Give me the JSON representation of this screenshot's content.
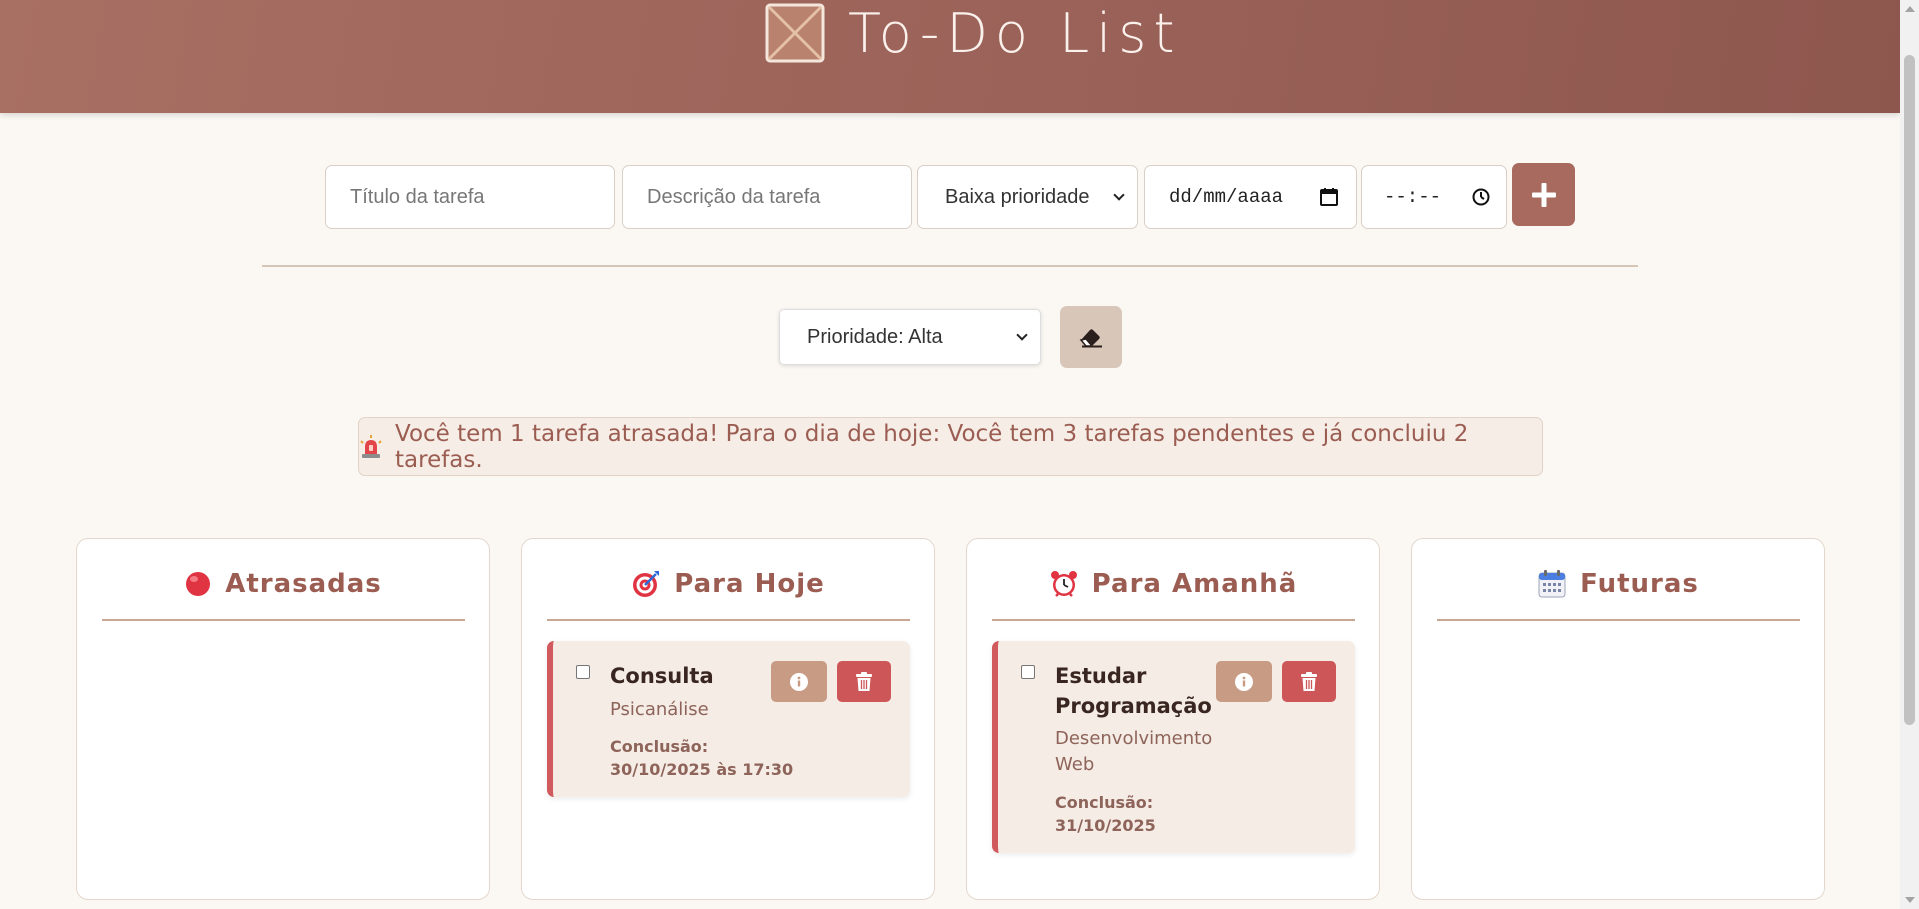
{
  "header": {
    "title": "To-Do List",
    "logo_icon": "checkbox-x-icon"
  },
  "form": {
    "title_placeholder": "Título da tarefa",
    "description_placeholder": "Descrição da tarefa",
    "priority_selected": "Baixa prioridade",
    "date_placeholder": "dd/mm/aaaa",
    "time_placeholder": "--:--",
    "add_icon": "plus-icon"
  },
  "filter": {
    "priority_selected": "Prioridade: Alta",
    "clear_icon": "eraser-icon"
  },
  "alert": {
    "icon": "siren-icon",
    "text": "Você tem 1 tarefa atrasada! Para o dia de hoje: Você tem 3 tarefas pendentes e já concluiu 2 tarefas."
  },
  "columns": [
    {
      "title": "Atrasadas",
      "icon": "red-circle-icon",
      "tasks": []
    },
    {
      "title": "Para Hoje",
      "icon": "target-icon",
      "tasks": [
        {
          "title": "Consulta",
          "description": "Psicanálise",
          "conclusion_label": "Conclusão:",
          "conclusion_date": "30/10/2025 às 17:30"
        }
      ]
    },
    {
      "title": "Para Amanhã",
      "icon": "alarm-clock-icon",
      "tasks": [
        {
          "title": "Estudar Programação",
          "description": "Desenvolvimento Web",
          "conclusion_label": "Conclusão:",
          "conclusion_date": "31/10/2025"
        }
      ]
    },
    {
      "title": "Futuras",
      "icon": "calendar-icon",
      "tasks": []
    }
  ],
  "colors": {
    "header": "#9a6258",
    "accent": "#a86a5e",
    "danger": "#cc5658",
    "info": "#c89c84",
    "background": "#fbf8f4"
  }
}
